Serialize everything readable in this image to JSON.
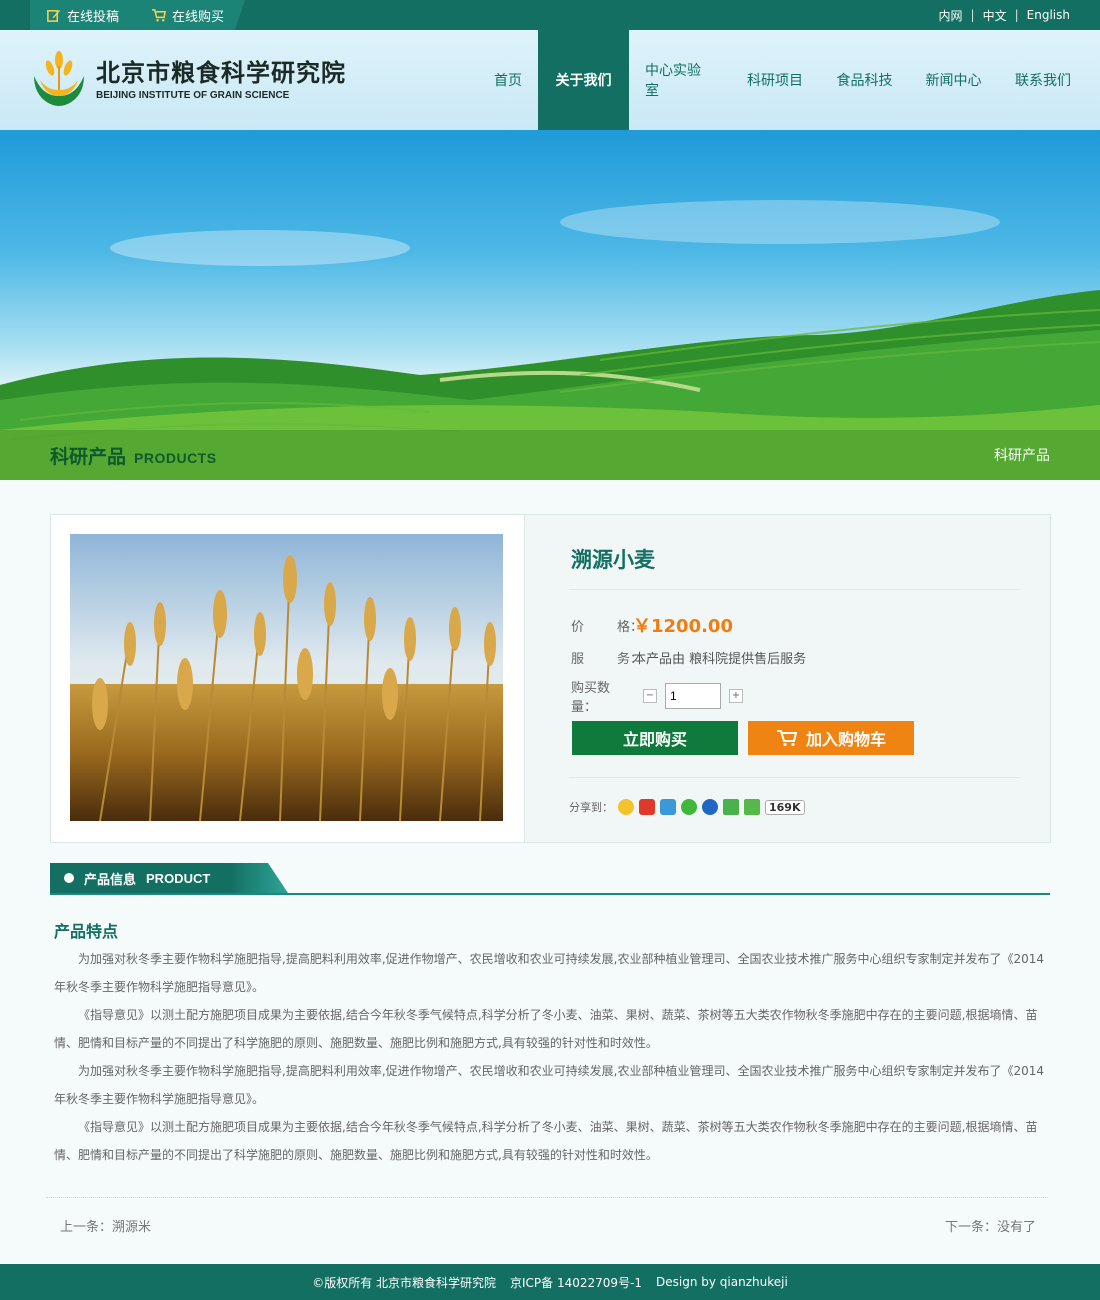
{
  "topbar": {
    "submit_label": "在线投稿",
    "buy_label": "在线购买",
    "langs": [
      "内网",
      "中文",
      "English"
    ],
    "lang_sep": "|"
  },
  "header": {
    "logo_cn": "北京市粮食科学研究院",
    "logo_en": "BEIJING INSTITUTE OF GRAIN SCIENCE",
    "nav": [
      "首页",
      "关于我们",
      "中心实验室",
      "科研项目",
      "食品科技",
      "新闻中心",
      "联系我们"
    ],
    "active_nav": "关于我们"
  },
  "banner": {
    "title_cn": "科研产品",
    "title_en": "PRODUCTS",
    "breadcrumb": "科研产品"
  },
  "product": {
    "name": "溯源小麦",
    "price_label": "价        格：",
    "price": "￥1200.00",
    "service_label": "服        务：",
    "service": "本产品由 粮科院提供售后服务",
    "qty_label": "购买数量：",
    "qty_minus": "−",
    "qty_value": "1",
    "qty_plus": "+",
    "buy_now": "立即购买",
    "add_cart": "加入购物车",
    "share_label": "分享到：",
    "share_count": "169K"
  },
  "section": {
    "title_cn": "产品信息",
    "title_en": "PRODUCT",
    "feature_title": "产品特点",
    "paragraphs": [
      "为加强对秋冬季主要作物科学施肥指导,提高肥料利用效率,促进作物增产、农民增收和农业可持续发展,农业部种植业管理司、全国农业技术推广服务中心组织专家制定并发布了《2014年秋冬季主要作物科学施肥指导意见》。",
      "《指导意见》以测土配方施肥项目成果为主要依据,结合今年秋冬季气候特点,科学分析了冬小麦、油菜、果树、蔬菜、茶树等五大类农作物秋冬季施肥中存在的主要问题,根据墒情、苗情、肥情和目标产量的不同提出了科学施肥的原则、施肥数量、施肥比例和施肥方式,具有较强的针对性和时效性。",
      "为加强对秋冬季主要作物科学施肥指导,提高肥料利用效率,促进作物增产、农民增收和农业可持续发展,农业部种植业管理司、全国农业技术推广服务中心组织专家制定并发布了《2014年秋冬季主要作物科学施肥指导意见》。",
      "《指导意见》以测土配方施肥项目成果为主要依据,结合今年秋冬季气候特点,科学分析了冬小麦、油菜、果树、蔬菜、茶树等五大类农作物秋冬季施肥中存在的主要问题,根据墒情、苗情、肥情和目标产量的不同提出了科学施肥的原则、施肥数量、施肥比例和施肥方式,具有较强的针对性和时效性。"
    ]
  },
  "pager": {
    "prev": "上一条：溯源米",
    "next": "下一条：没有了"
  },
  "footer": {
    "copyright": "©版权所有  北京市粮食科学研究院",
    "icp": "京ICP备 14022709号-1",
    "design": "Design by qianzhukeji"
  },
  "colors": {
    "brand": "#126f62",
    "accent": "#f08412",
    "buy": "#0e7a3b"
  }
}
